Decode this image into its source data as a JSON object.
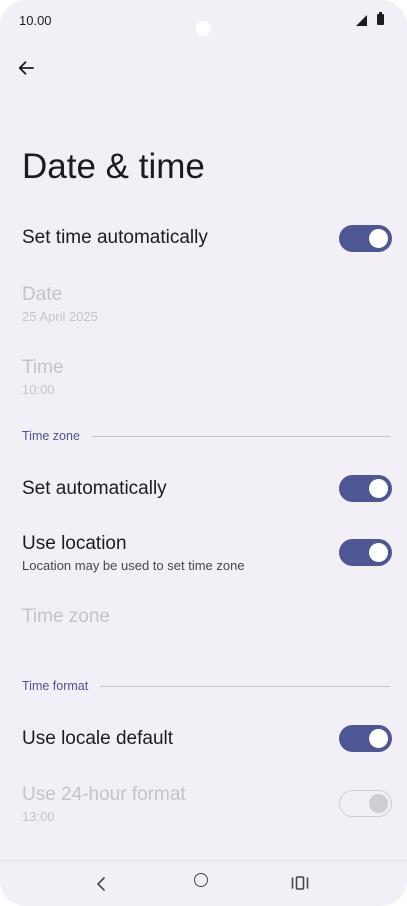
{
  "status_bar": {
    "time": "10.00",
    "icons": [
      "signal-icon",
      "battery-icon"
    ]
  },
  "header": {
    "back_icon": "arrow-left-icon",
    "title": "Date & time"
  },
  "settings": {
    "set_time_automatically": {
      "title": "Set time automatically",
      "enabled": true
    },
    "date": {
      "title": "Date",
      "value": "25 April 2025"
    },
    "time": {
      "title": "Time",
      "value": "10:00"
    }
  },
  "time_zone_section": {
    "header": "Time zone",
    "set_automatically": {
      "title": "Set automatically",
      "enabled": true
    },
    "use_location": {
      "title": "Use location",
      "summary": "Location may be used to set time zone",
      "enabled": true
    },
    "time_zone": {
      "title": "Time zone"
    }
  },
  "time_format_section": {
    "header": "Time format",
    "use_locale_default": {
      "title": "Use locale default",
      "enabled": true
    },
    "use_24_hour": {
      "title": "Use 24-hour format",
      "summary": "13:00",
      "enabled": true,
      "disabled": true
    }
  },
  "nav_bar": {
    "icons": [
      "nav-back-icon",
      "nav-home-icon",
      "nav-recents-icon"
    ]
  },
  "colors": {
    "accent": "#4e5693",
    "background": "#f3eff6",
    "section_header": "#4b5394",
    "disabled_text": "#c5c2c9"
  }
}
